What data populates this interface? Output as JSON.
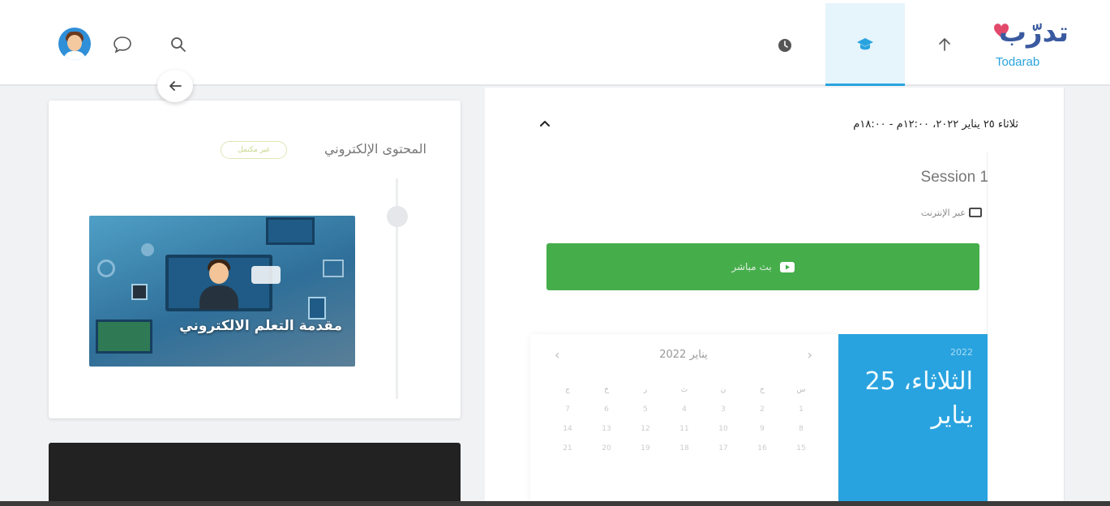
{
  "header": {
    "logo_ar": "تدرّب",
    "logo_en": "Todarab",
    "colors": {
      "accent": "#29a3df",
      "brand": "#3a5aa0",
      "heart": "#e24a6b"
    }
  },
  "content": {
    "title": "المحتوى الإلكتروني",
    "badge": "غير مكتمل",
    "item_title": "مقدمة التعلم الالكتروني"
  },
  "session": {
    "date_text": "ثلاثاء ٢٥ يناير ٢٠٢٢، ١٢:٠٠م - ١٨:٠٠م",
    "name": "Session 1",
    "mode": "عبر الإنترنت",
    "live_button": "بث مباشر",
    "live_color": "#46ad4b"
  },
  "calendar": {
    "month_label": "يناير 2022",
    "year": "2022",
    "selected_day": "الثلاثاء، 25 يناير",
    "weekdays": [
      "س",
      "ح",
      "ن",
      "ث",
      "ر",
      "خ",
      "ج"
    ],
    "rows": [
      [
        "1",
        "2",
        "3",
        "4",
        "5",
        "6",
        "7"
      ],
      [
        "8",
        "9",
        "10",
        "11",
        "12",
        "13",
        "14"
      ],
      [
        "15",
        "16",
        "17",
        "18",
        "19",
        "20",
        "21"
      ]
    ]
  }
}
